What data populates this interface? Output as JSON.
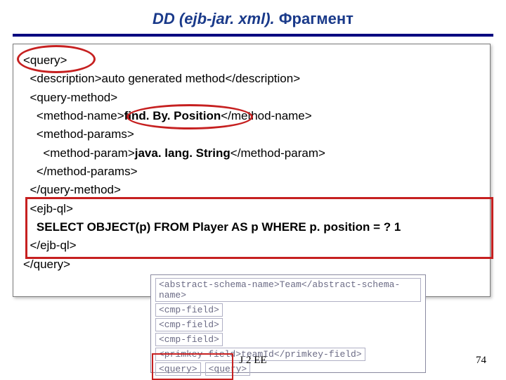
{
  "title": {
    "main": "DD (ejb-jar. xml).",
    "frag": "Фрагмент"
  },
  "code": {
    "l1": "<query>",
    "l2_a": "  <description>",
    "l2_b": "auto generated method",
    "l2_c": "</description>",
    "l3": "  <query-method>",
    "l4_a": "    <method-name>",
    "l4_b": "find. By. Position",
    "l4_c": "</method-name>",
    "l5": "    <method-params>",
    "l6_a": "      <method-param>",
    "l6_b": "java. lang. String",
    "l6_c": "</method-param>",
    "l7": "    </method-params>",
    "l8": "  </query-method>",
    "l9": "  <ejb-ql>",
    "l10": "    SELECT OBJECT(p) FROM Player AS p WHERE p. position = ? 1",
    "l11": "  </ejb-ql>",
    "l12": "</query>"
  },
  "inset": {
    "r1": "<abstract-schema-name>Team</abstract-schema-name>",
    "r2": "<cmp-field>",
    "r3": "<cmp-field>",
    "r4": "<cmp-field>",
    "r5": "<primkey-field>teamId</primkey-field>",
    "r6a": "<query>",
    "r6b": "<query>"
  },
  "footer": {
    "center": "J 2 EE",
    "num": "74"
  }
}
